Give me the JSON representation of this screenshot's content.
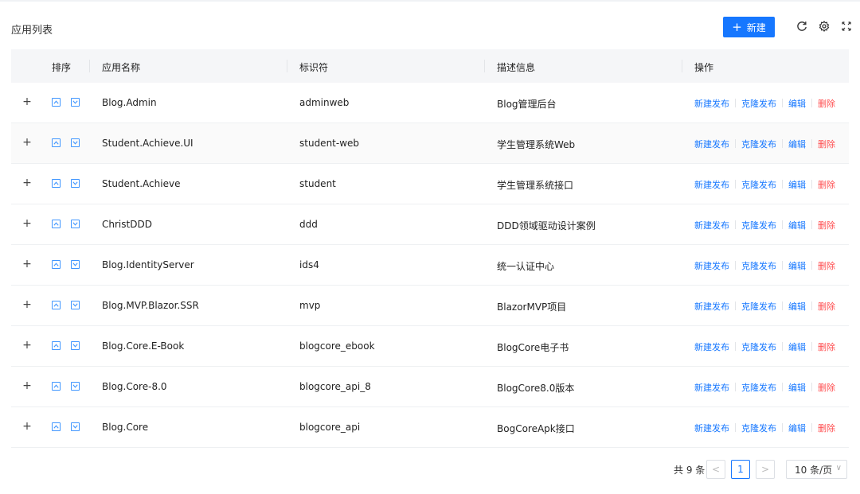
{
  "header": {
    "title": "应用列表",
    "new_label": "新建",
    "icons": [
      "refresh-icon",
      "settings-icon",
      "fullscreen-icon"
    ]
  },
  "table": {
    "columns": [
      "排序",
      "应用名称",
      "标识符",
      "描述信息",
      "操作"
    ],
    "actions": [
      "新建发布",
      "克隆发布",
      "编辑",
      "删除"
    ],
    "rows": [
      {
        "name": "Blog.Admin",
        "id": "adminweb",
        "desc": "Blog管理后台"
      },
      {
        "name": "Student.Achieve.UI",
        "id": "student-web",
        "desc": "学生管理系统Web"
      },
      {
        "name": "Student.Achieve",
        "id": "student",
        "desc": "学生管理系统接口"
      },
      {
        "name": "ChristDDD",
        "id": "ddd",
        "desc": "DDD领域驱动设计案例"
      },
      {
        "name": "Blog.IdentityServer",
        "id": "ids4",
        "desc": "统一认证中心"
      },
      {
        "name": "Blog.MVP.Blazor.SSR",
        "id": "mvp",
        "desc": "BlazorMVP项目"
      },
      {
        "name": "Blog.Core.E-Book",
        "id": "blogcore_ebook",
        "desc": "BlogCore电子书"
      },
      {
        "name": "Blog.Core-8.0",
        "id": "blogcore_api_8",
        "desc": "BlogCore8.0版本"
      },
      {
        "name": "Blog.Core",
        "id": "blogcore_api",
        "desc": "BogCoreApk接口"
      }
    ]
  },
  "pagination": {
    "total_text": "共 9 条",
    "prev": "<",
    "current": "1",
    "next": ">",
    "page_size": "10 条/页"
  },
  "colors": {
    "primary": "#1677ff",
    "danger": "#ff4d4f",
    "header_bg": "#f5f6f8"
  }
}
